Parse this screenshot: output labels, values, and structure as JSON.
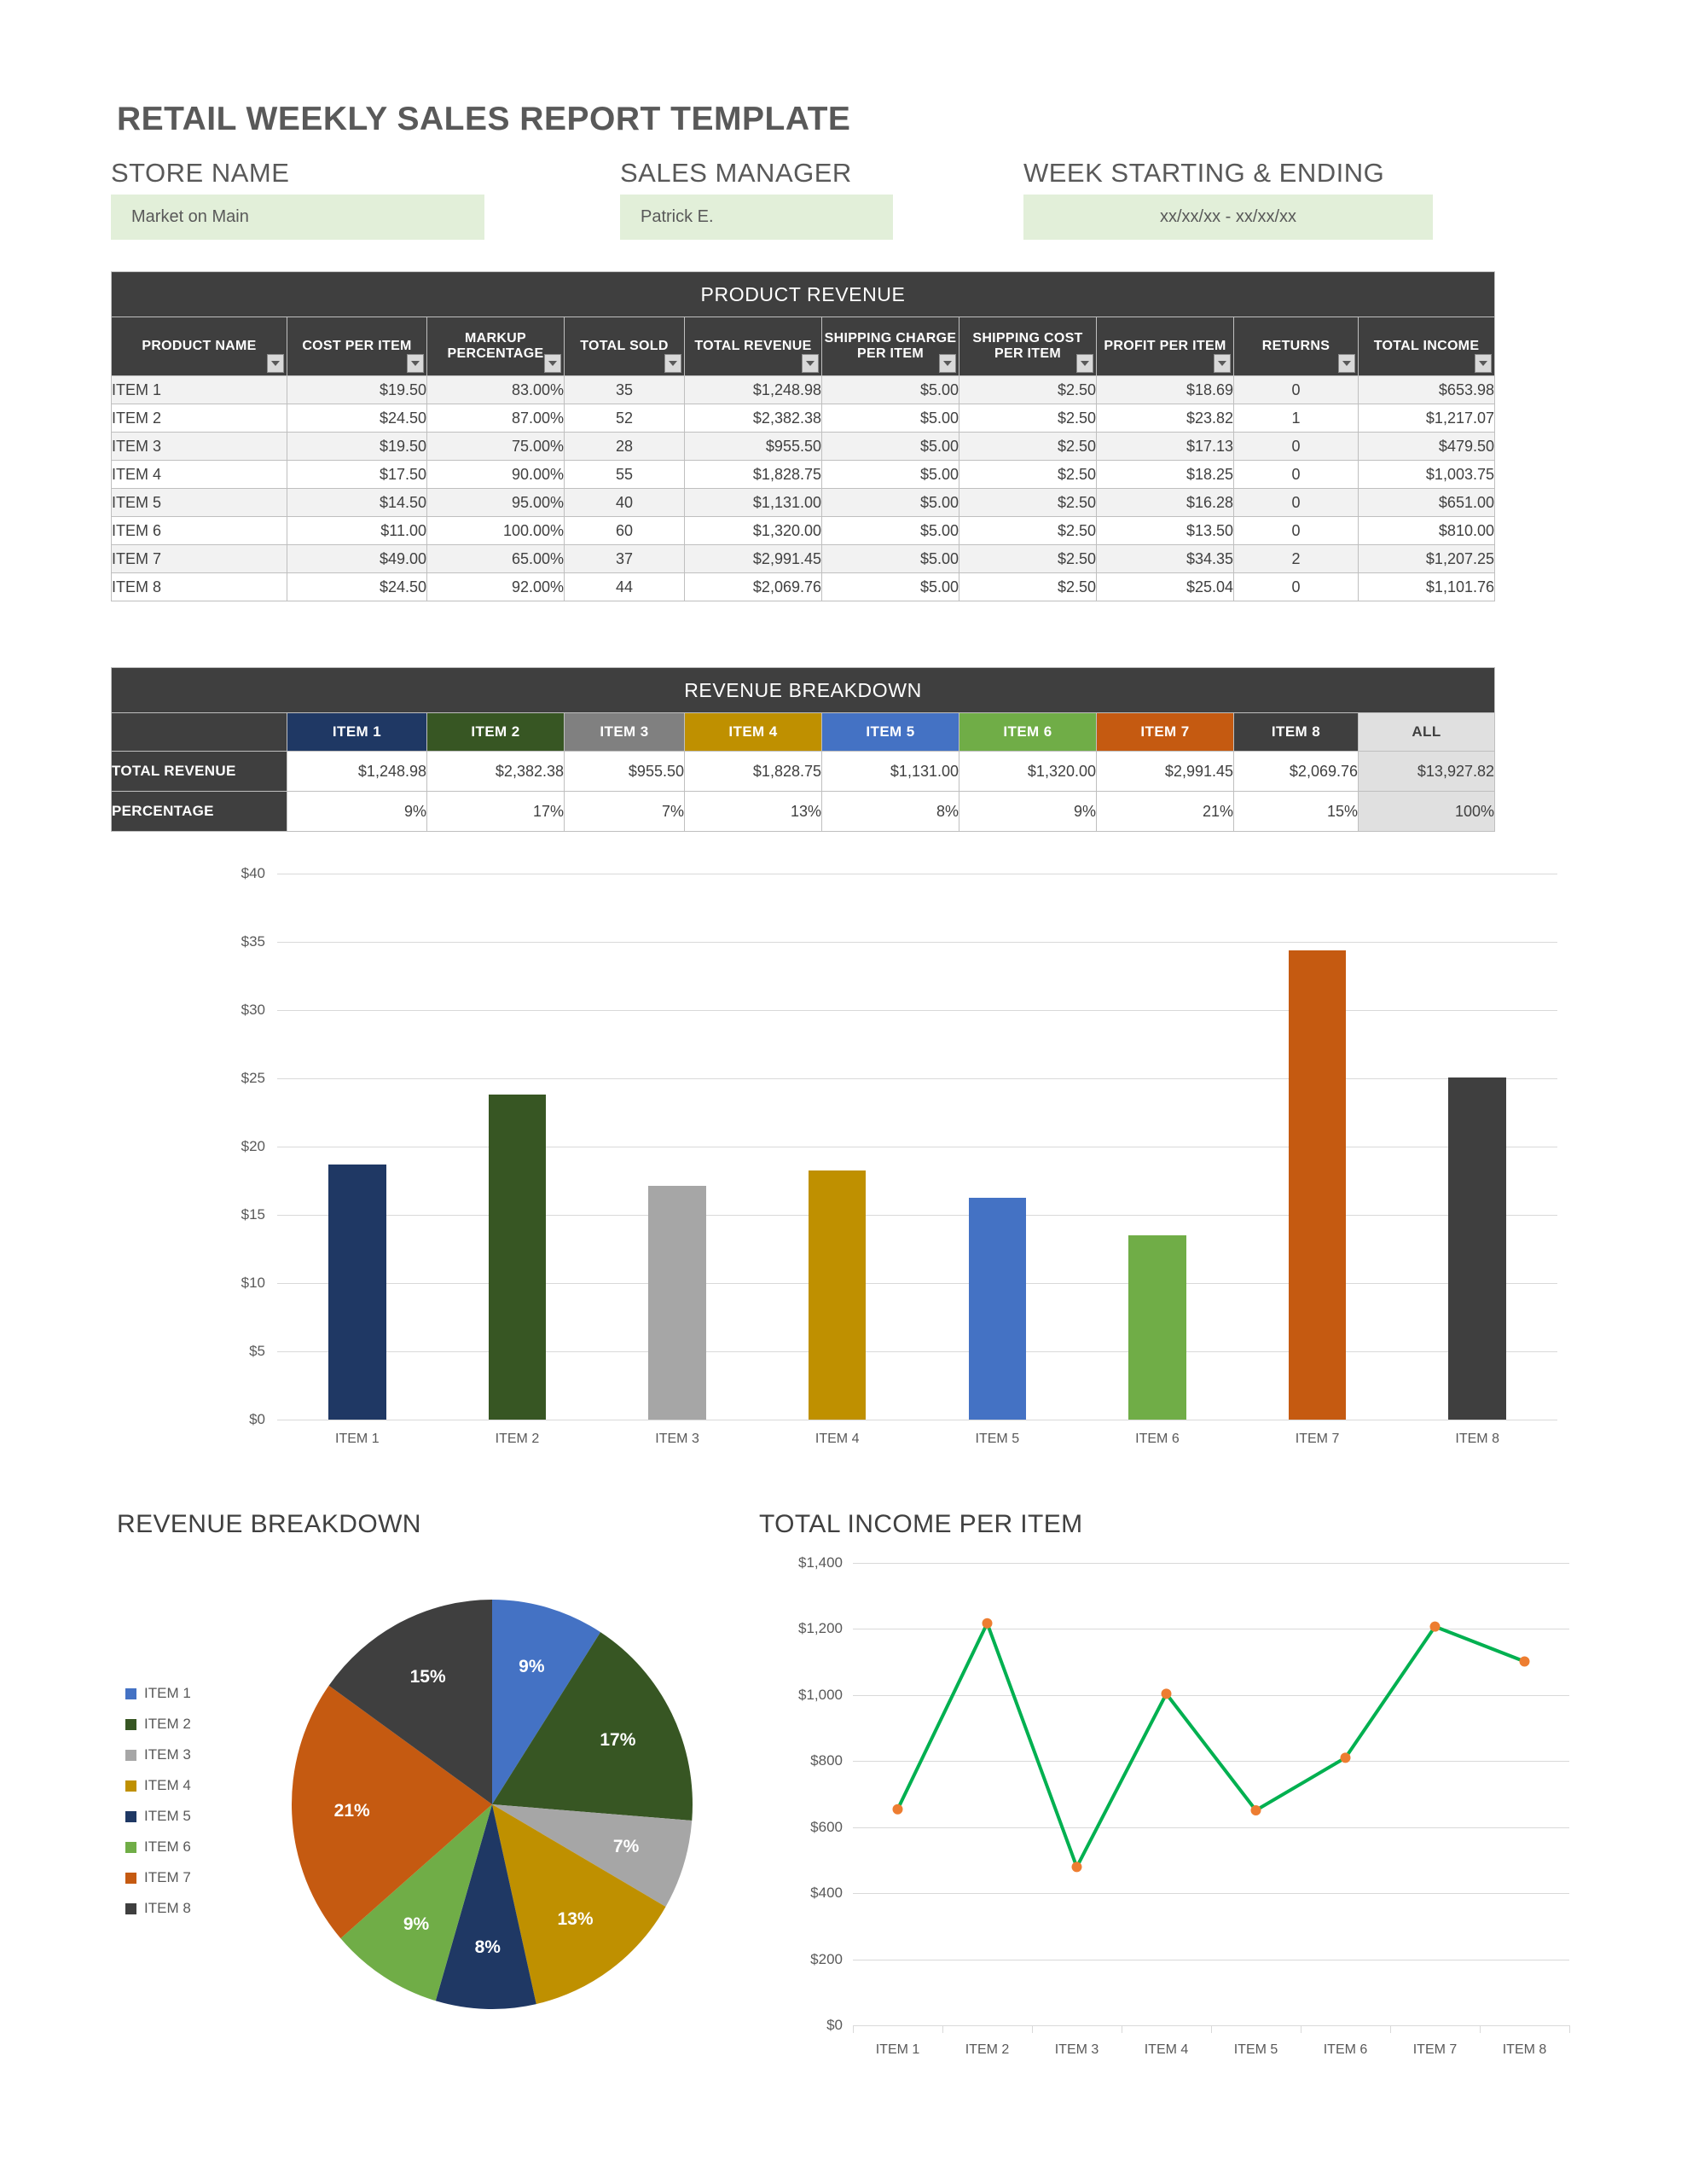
{
  "document": {
    "title": "RETAIL WEEKLY SALES REPORT TEMPLATE"
  },
  "header_fields": [
    {
      "label": "STORE NAME",
      "value": "Market on Main"
    },
    {
      "label": "SALES MANAGER",
      "value": "Patrick E."
    },
    {
      "label": "WEEK STARTING & ENDING",
      "value": "xx/xx/xx - xx/xx/xx"
    }
  ],
  "product_revenue": {
    "band_title": "PRODUCT REVENUE",
    "columns": [
      "PRODUCT NAME",
      "COST PER ITEM",
      "MARKUP PERCENTAGE",
      "TOTAL SOLD",
      "TOTAL REVENUE",
      "SHIPPING CHARGE PER ITEM",
      "SHIPPING COST PER ITEM",
      "PROFIT PER ITEM",
      "RETURNS",
      "TOTAL INCOME"
    ],
    "rows": [
      [
        "ITEM 1",
        "$19.50",
        "83.00%",
        "35",
        "$1,248.98",
        "$5.00",
        "$2.50",
        "$18.69",
        "0",
        "$653.98"
      ],
      [
        "ITEM 2",
        "$24.50",
        "87.00%",
        "52",
        "$2,382.38",
        "$5.00",
        "$2.50",
        "$23.82",
        "1",
        "$1,217.07"
      ],
      [
        "ITEM 3",
        "$19.50",
        "75.00%",
        "28",
        "$955.50",
        "$5.00",
        "$2.50",
        "$17.13",
        "0",
        "$479.50"
      ],
      [
        "ITEM 4",
        "$17.50",
        "90.00%",
        "55",
        "$1,828.75",
        "$5.00",
        "$2.50",
        "$18.25",
        "0",
        "$1,003.75"
      ],
      [
        "ITEM 5",
        "$14.50",
        "95.00%",
        "40",
        "$1,131.00",
        "$5.00",
        "$2.50",
        "$16.28",
        "0",
        "$651.00"
      ],
      [
        "ITEM 6",
        "$11.00",
        "100.00%",
        "60",
        "$1,320.00",
        "$5.00",
        "$2.50",
        "$13.50",
        "0",
        "$810.00"
      ],
      [
        "ITEM 7",
        "$49.00",
        "65.00%",
        "37",
        "$2,991.45",
        "$5.00",
        "$2.50",
        "$34.35",
        "2",
        "$1,207.25"
      ],
      [
        "ITEM 8",
        "$24.50",
        "92.00%",
        "44",
        "$2,069.76",
        "$5.00",
        "$2.50",
        "$25.04",
        "0",
        "$1,101.76"
      ]
    ]
  },
  "revenue_breakdown_table": {
    "band_title": "REVENUE BREAKDOWN",
    "item_headers": [
      "ITEM 1",
      "ITEM 2",
      "ITEM 3",
      "ITEM 4",
      "ITEM 5",
      "ITEM 6",
      "ITEM 7",
      "ITEM 8",
      "ALL"
    ],
    "item_header_colors": [
      "#1f3864",
      "#375623",
      "#808080",
      "#bf9000",
      "#4472c4",
      "#70ad47",
      "#c55a11",
      "#3f3f3f",
      "#e0e0e0"
    ],
    "rows": [
      {
        "label": "TOTAL REVENUE",
        "values": [
          "$1,248.98",
          "$2,382.38",
          "$955.50",
          "$1,828.75",
          "$1,131.00",
          "$1,320.00",
          "$2,991.45",
          "$2,069.76",
          "$13,927.82"
        ]
      },
      {
        "label": "PERCENTAGE",
        "values": [
          "9%",
          "17%",
          "7%",
          "13%",
          "8%",
          "9%",
          "21%",
          "15%",
          "100%"
        ]
      }
    ]
  },
  "chart_data": [
    {
      "type": "bar",
      "title": "",
      "xlabel": "",
      "ylabel": "",
      "categories": [
        "ITEM 1",
        "ITEM 2",
        "ITEM 3",
        "ITEM 4",
        "ITEM 5",
        "ITEM 6",
        "ITEM 7",
        "ITEM 8"
      ],
      "values": [
        18.69,
        23.82,
        17.13,
        18.25,
        16.28,
        13.5,
        34.35,
        25.04
      ],
      "colors": [
        "#1f3864",
        "#375623",
        "#a6a6a6",
        "#bf9000",
        "#4472c4",
        "#70ad47",
        "#c55a11",
        "#3f3f3f"
      ],
      "ylim": [
        0,
        40
      ],
      "yticks": [
        0,
        5,
        10,
        15,
        20,
        25,
        30,
        35,
        40
      ],
      "ytick_labels": [
        "$0",
        "$5",
        "$10",
        "$15",
        "$20",
        "$25",
        "$30",
        "$35",
        "$40"
      ],
      "grid": true,
      "legend": "none"
    },
    {
      "type": "pie",
      "title": "REVENUE BREAKDOWN",
      "labels": [
        "ITEM 1",
        "ITEM 2",
        "ITEM 3",
        "ITEM 4",
        "ITEM 5",
        "ITEM 6",
        "ITEM 7",
        "ITEM 8"
      ],
      "values": [
        9,
        17,
        7,
        13,
        8,
        9,
        21,
        15
      ],
      "value_labels": [
        "9%",
        "17%",
        "7%",
        "13%",
        "8%",
        "9%",
        "21%",
        "15%"
      ],
      "colors": [
        "#4472c4",
        "#375623",
        "#a6a6a6",
        "#bf9000",
        "#1f3864",
        "#70ad47",
        "#c55a11",
        "#3f3f3f"
      ],
      "legend": "left"
    },
    {
      "type": "line",
      "title": "TOTAL INCOME PER ITEM",
      "xlabel": "",
      "ylabel": "",
      "categories": [
        "ITEM 1",
        "ITEM 2",
        "ITEM 3",
        "ITEM 4",
        "ITEM 5",
        "ITEM 6",
        "ITEM 7",
        "ITEM 8"
      ],
      "values": [
        653.98,
        1217.07,
        479.5,
        1003.75,
        651.0,
        810.0,
        1207.25,
        1101.76
      ],
      "ylim": [
        0,
        1400
      ],
      "yticks": [
        0,
        200,
        400,
        600,
        800,
        1000,
        1200,
        1400
      ],
      "ytick_labels": [
        "$0",
        "$200",
        "$400",
        "$600",
        "$800",
        "$1,000",
        "$1,200",
        "$1,400"
      ],
      "line_color": "#00b050",
      "marker_color": "#ed7d31",
      "grid": true,
      "legend": "none"
    }
  ]
}
